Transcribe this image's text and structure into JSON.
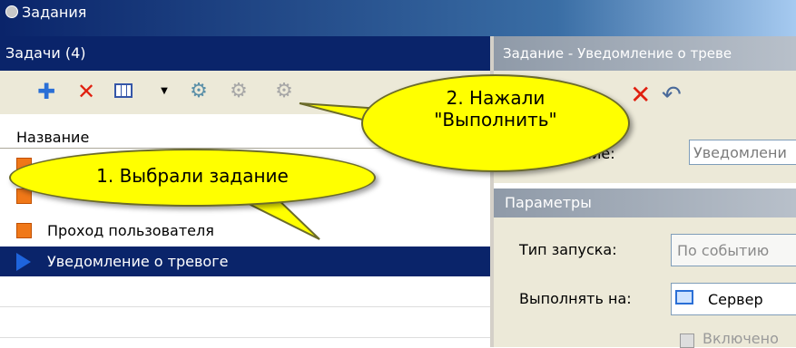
{
  "window": {
    "title": "Задания"
  },
  "tasks_panel": {
    "title": "Задачи (4)",
    "column_header": "Название"
  },
  "tasks": [
    {
      "label": "",
      "selected": false
    },
    {
      "label": "",
      "selected": false
    },
    {
      "label": "Проход пользователя",
      "selected": false
    },
    {
      "label": "Уведомление о тревоге",
      "selected": true
    }
  ],
  "detail_panel": {
    "title": "Задание - Уведомление о треве",
    "name_label": "азвание:",
    "name_value": "Уведомлени",
    "params_header": "Параметры",
    "launch_type_label": "Тип запуска:",
    "launch_type_value": "По событию",
    "run_on_label": "Выполнять на:",
    "run_on_value": "Сервер",
    "enabled_label": "Включено"
  },
  "callouts": {
    "step1": "1. Выбрали задание",
    "step2_line1": "2. Нажали",
    "step2_line2": "\"Выполнить\""
  },
  "colors": {
    "selection": "#0a246a",
    "callout": "#ffff00",
    "task_icon": "#f07818"
  }
}
